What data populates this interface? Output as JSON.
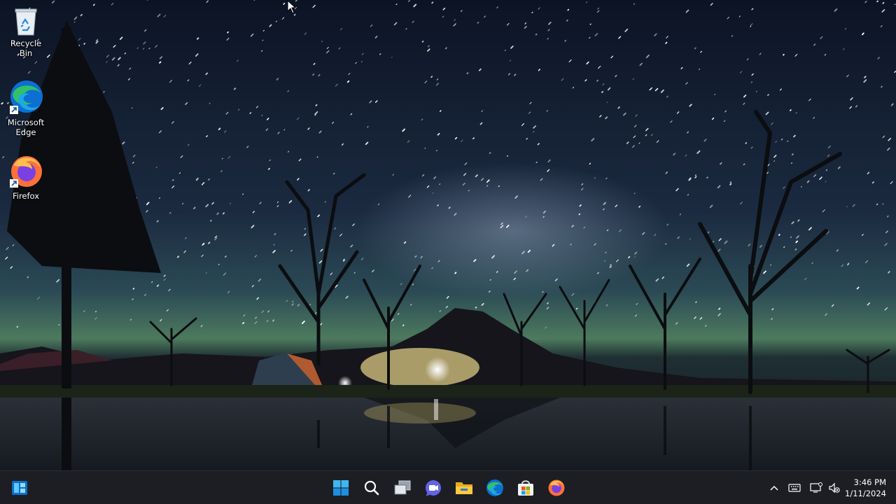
{
  "desktop": {
    "icons": [
      {
        "label": "Recycle Bin"
      },
      {
        "label": "Microsoft Edge"
      },
      {
        "label": "Firefox"
      }
    ]
  },
  "taskbar": {
    "pinned": [
      "windows-start-icon",
      "search-icon",
      "task-view-icon",
      "teams-chat-icon",
      "file-explorer-icon",
      "edge-icon",
      "microsoft-store-icon",
      "firefox-icon"
    ],
    "tray": [
      "chevron-up-icon",
      "keyboard-icon",
      "network-icon",
      "volume-muted-icon"
    ],
    "clock": {
      "time": "3:46 PM",
      "date": "1/11/2024"
    }
  },
  "colors": {
    "taskbar_bg": "#1c1e24",
    "windows_blue": "#0ea5e9",
    "edge_blue": "#0c6fd1",
    "edge_green": "#32c06a",
    "firefox_orange": "#ff7139",
    "firefox_purple": "#7b3fe4"
  }
}
